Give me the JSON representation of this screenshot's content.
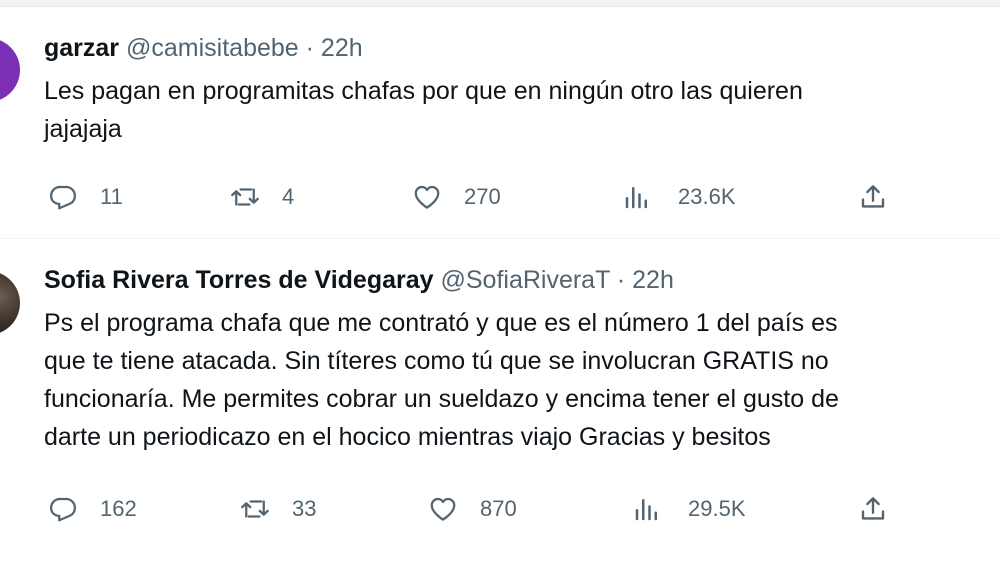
{
  "tweets": [
    {
      "display_name": "garzar",
      "handle": "@camisitabebe",
      "separator": "·",
      "time": "22h",
      "text_lines": [
        "Les pagan en programitas chafas por que en ningún otro las quieren",
        "jajajaja"
      ],
      "stats": {
        "replies": "11",
        "retweets": "4",
        "likes": "270",
        "views": "23.6K"
      },
      "avatar_color": "#7b2fb5"
    },
    {
      "display_name": "Sofia Rivera Torres de Videgaray",
      "handle": "@SofiaRiveraT",
      "separator": "·",
      "time": "22h",
      "text_lines": [
        "Ps el programa chafa que me contrató y que es el número 1 del país es",
        "que te tiene atacada. Sin títeres como tú que se involucran GRATIS no",
        "funcionaría. Me permites cobrar un sueldazo y encima tener el gusto de",
        "darte un periodicazo en el hocico mientras viajo Gracias y besitos"
      ],
      "stats": {
        "replies": "162",
        "retweets": "33",
        "likes": "870",
        "views": "29.5K"
      }
    }
  ],
  "colors": {
    "text": "#0f1419",
    "secondary": "#536471",
    "divider": "#eff3f4"
  },
  "icons": [
    "reply-icon",
    "retweet-icon",
    "like-icon",
    "views-icon",
    "share-icon"
  ]
}
